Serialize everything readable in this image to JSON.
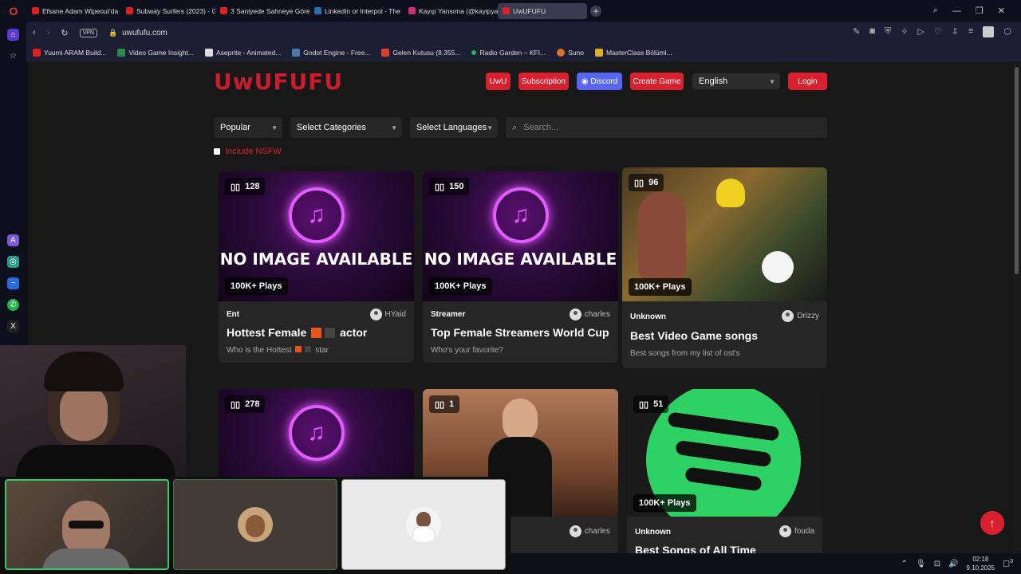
{
  "tabs": [
    {
      "label": "Efsane Adam Wipeout'da",
      "color": "#e02020"
    },
    {
      "label": "Subway Surfers (2023) - G",
      "color": "#e02020"
    },
    {
      "label": "3 Saniyede Sahneye Göre",
      "color": "#e02020"
    },
    {
      "label": "LinkedIn or Interpol - The",
      "color": "#2a6fb0"
    },
    {
      "label": "Kayıp Yansıma (@kayipyan",
      "color": "#d0307a"
    },
    {
      "label": "UwUFUFU",
      "color": "#d8202e"
    }
  ],
  "address": {
    "vpn": "VPN",
    "url": "uwufufu.com"
  },
  "bookmarks": [
    {
      "label": "Yuumi ARAM Build...",
      "color": "#e02020"
    },
    {
      "label": "Video Game Insight...",
      "color": "#2a8a4a"
    },
    {
      "label": "Aseprite - Animated...",
      "color": "#dddddd"
    },
    {
      "label": "Godot Engine - Free...",
      "color": "#4a7ab0"
    },
    {
      "label": "Gelen Kutusu (8.355...",
      "color": "#e04030"
    },
    {
      "label": "Radio Garden – KFI...",
      "color": "#30b050"
    },
    {
      "label": "Suno",
      "color": "#e07030"
    },
    {
      "label": "MasterClass Bölüml...",
      "color": "#e0b020"
    }
  ],
  "site": {
    "logo": "UwUFUFU",
    "nav": {
      "uwu": "UwU",
      "subscription": "Subscription",
      "discord": "Discord",
      "create": "Create Game",
      "login": "Login"
    },
    "language": "English",
    "filters": {
      "sort": "Popular",
      "categories": "Select Categories",
      "languages": "Select Languages",
      "search_placeholder": "Search..."
    },
    "nsfw_label": "Include NSFW",
    "no_image_text": "NO IMAGE AVAILABLE"
  },
  "cards": [
    {
      "count": "128",
      "plays": "100K+ Plays",
      "category": "Ent",
      "author": "HYaid",
      "title_a": "Hottest Female",
      "title_b": "actor",
      "desc_a": "Who is the Hottest",
      "desc_b": "star",
      "thumb": "noimg"
    },
    {
      "count": "150",
      "plays": "100K+ Plays",
      "category": "Streamer",
      "author": "charles",
      "title": "Top Female Streamers World Cup",
      "desc": "Who's your favorite?",
      "thumb": "noimg"
    },
    {
      "count": "96",
      "plays": "100K+ Plays",
      "category": "Unknown",
      "author": "Drizzy",
      "title": "Best Video Game songs",
      "desc": "Best songs from my list of ost's",
      "thumb": "game"
    },
    {
      "count": "278",
      "thumb": "noimg"
    },
    {
      "count": "1",
      "author": "charles",
      "thumb": "photo"
    },
    {
      "count": "51",
      "plays": "100K+ Plays",
      "category": "Unknown",
      "author": "fouda",
      "title": "Best Songs of All Time",
      "thumb": "spotify"
    }
  ],
  "colors": {
    "accent": "#d8202e",
    "discord": "#5865f2",
    "spotify": "#2ed163"
  },
  "taskbar": {
    "time": "02:18",
    "date": "9.10.2025",
    "notifications": "3"
  }
}
